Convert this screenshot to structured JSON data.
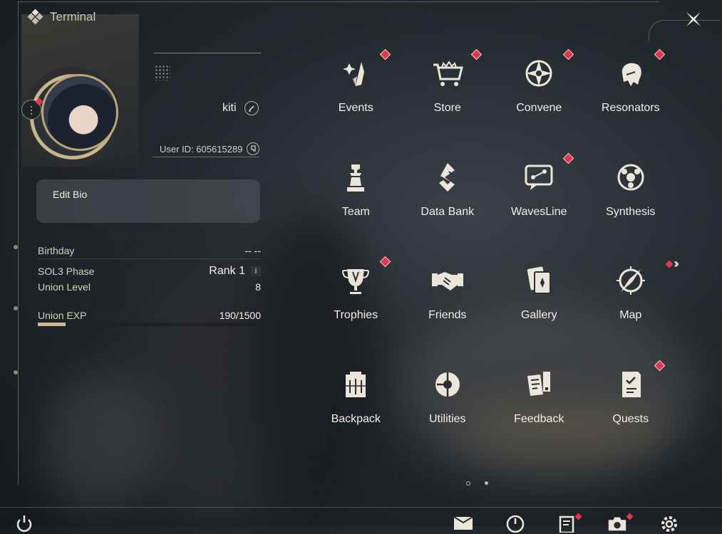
{
  "header": {
    "title": "Terminal"
  },
  "profile": {
    "username": "kiti",
    "user_id": "User ID: 605615289",
    "bio_label": "Edit Bio"
  },
  "stats": {
    "birthday_label": "Birthday",
    "birthday_value": "-- --",
    "phase_label": "SOL3 Phase",
    "phase_value": "Rank 1",
    "phase_info": "i",
    "union_level_label": "Union Level",
    "union_level_value": "8",
    "union_exp_label": "Union EXP",
    "union_exp_value": "190/1500",
    "union_exp_fraction": 0.127
  },
  "menu": {
    "items": [
      {
        "label": "Events",
        "icon": "events-icon",
        "notify": true
      },
      {
        "label": "Store",
        "icon": "store-cart-icon",
        "notify": true
      },
      {
        "label": "Convene",
        "icon": "convene-star-icon",
        "notify": true
      },
      {
        "label": "Resonators",
        "icon": "resonators-icon",
        "notify": true
      },
      {
        "label": "Team",
        "icon": "team-chess-icon",
        "notify": false
      },
      {
        "label": "Data Bank",
        "icon": "data-bank-icon",
        "notify": false
      },
      {
        "label": "WavesLine",
        "icon": "wavesline-chat-icon",
        "notify": true
      },
      {
        "label": "Synthesis",
        "icon": "synthesis-icon",
        "notify": false
      },
      {
        "label": "Trophies",
        "icon": "trophy-icon",
        "notify": true
      },
      {
        "label": "Friends",
        "icon": "handshake-icon",
        "notify": false
      },
      {
        "label": "Gallery",
        "icon": "gallery-cards-icon",
        "notify": false
      },
      {
        "label": "Map",
        "icon": "map-compass-icon",
        "notify": false
      },
      {
        "label": "Backpack",
        "icon": "backpack-icon",
        "notify": false
      },
      {
        "label": "Utilities",
        "icon": "utilities-icon",
        "notify": false
      },
      {
        "label": "Feedback",
        "icon": "feedback-icon",
        "notify": false
      },
      {
        "label": "Quests",
        "icon": "quests-icon",
        "notify": true
      }
    ]
  },
  "colors": {
    "accent": "#cdb98e",
    "notify": "#e0364f",
    "text": "#f4efe5"
  }
}
